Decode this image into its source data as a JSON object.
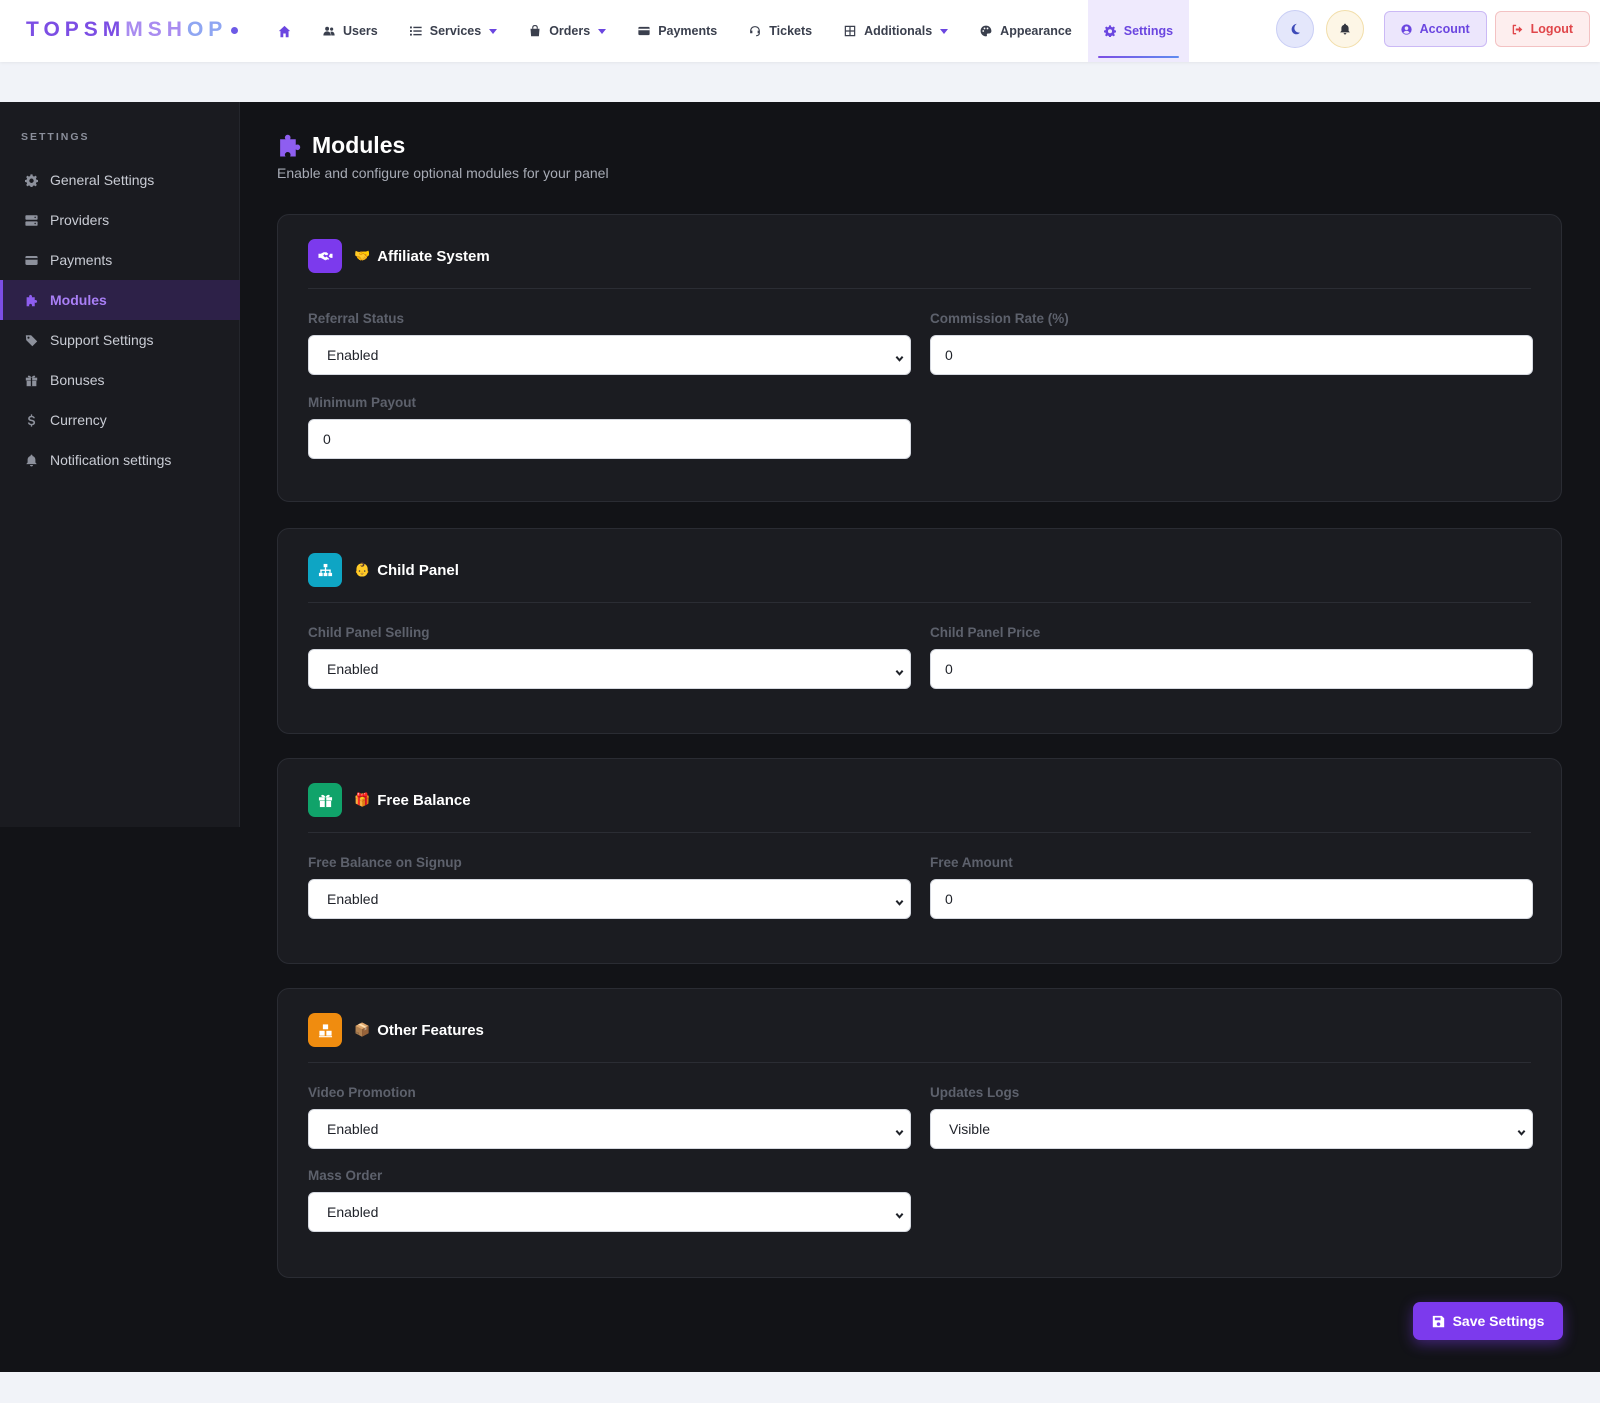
{
  "brand": {
    "part1": "TOPSM",
    "part2": "MSH",
    "part3": "OP"
  },
  "nav": {
    "home_icon": "home-icon",
    "items": [
      {
        "label": "Users",
        "icon": "users-icon",
        "dropdown": false
      },
      {
        "label": "Services",
        "icon": "list-icon",
        "dropdown": true
      },
      {
        "label": "Orders",
        "icon": "bag-icon",
        "dropdown": true
      },
      {
        "label": "Payments",
        "icon": "credit-card-icon",
        "dropdown": false
      },
      {
        "label": "Tickets",
        "icon": "headset-icon",
        "dropdown": false
      },
      {
        "label": "Additionals",
        "icon": "grid-icon",
        "dropdown": true
      },
      {
        "label": "Appearance",
        "icon": "palette-icon",
        "dropdown": false
      },
      {
        "label": "Settings",
        "icon": "gear-icon",
        "dropdown": false,
        "active": true
      }
    ],
    "account_label": "Account",
    "logout_label": "Logout"
  },
  "sidebar": {
    "heading": "SETTINGS",
    "items": [
      {
        "label": "General Settings",
        "icon": "gear-icon"
      },
      {
        "label": "Providers",
        "icon": "server-icon"
      },
      {
        "label": "Payments",
        "icon": "credit-card-icon"
      },
      {
        "label": "Modules",
        "icon": "puzzle-icon",
        "active": true
      },
      {
        "label": "Support Settings",
        "icon": "tag-icon"
      },
      {
        "label": "Bonuses",
        "icon": "gift-icon"
      },
      {
        "label": "Currency",
        "icon": "dollar-icon"
      },
      {
        "label": "Notification settings",
        "icon": "bell-icon"
      }
    ]
  },
  "page": {
    "title": "Modules",
    "subtitle": "Enable and configure optional modules for your panel"
  },
  "sections": {
    "affiliate": {
      "emoji": "🤝",
      "title": "Affiliate System",
      "icon_color": "#7c3aed",
      "referral_status_label": "Referral Status",
      "referral_status_value": "Enabled",
      "commission_rate_label": "Commission Rate (%)",
      "commission_rate_value": "0",
      "minimum_payout_label": "Minimum Payout",
      "minimum_payout_value": "0"
    },
    "child_panel": {
      "emoji": "👶",
      "title": "Child Panel",
      "icon_color": "#0ea5c4",
      "selling_label": "Child Panel Selling",
      "selling_value": "Enabled",
      "price_label": "Child Panel Price",
      "price_value": "0"
    },
    "free_balance": {
      "emoji": "🎁",
      "title": "Free Balance",
      "icon_color": "#10a36a",
      "signup_label": "Free Balance on Signup",
      "signup_value": "Enabled",
      "amount_label": "Free Amount",
      "amount_value": "0"
    },
    "other": {
      "emoji": "📦",
      "title": "Other Features",
      "icon_color": "#f08c0f",
      "video_label": "Video Promotion",
      "video_value": "Enabled",
      "updates_label": "Updates Logs",
      "updates_value": "Visible",
      "mass_label": "Mass Order",
      "mass_value": "Enabled"
    }
  },
  "save_label": "Save Settings",
  "colors": {
    "accent": "#7c3aed",
    "background": "#121317",
    "card": "#1b1c21"
  }
}
